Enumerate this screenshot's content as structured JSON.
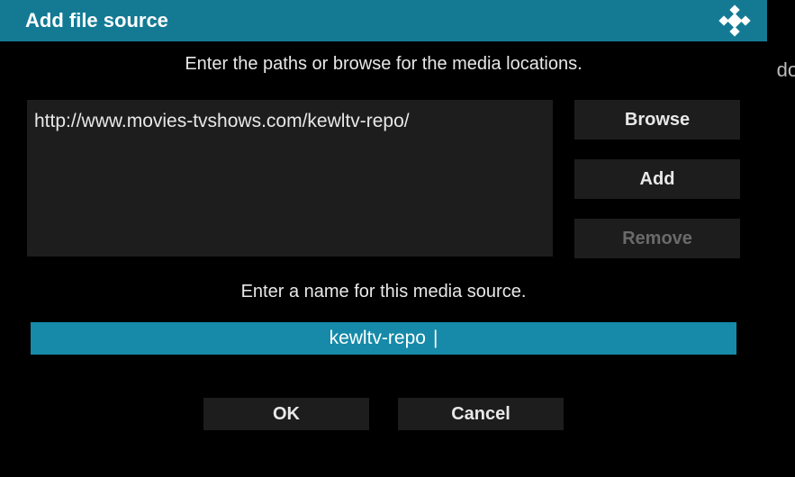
{
  "bg_text": "dow",
  "dialog": {
    "title": "Add file source",
    "instruction_paths": "Enter the paths or browse for the media locations.",
    "path_value": "http://www.movies-tvshows.com/kewltv-repo/",
    "buttons": {
      "browse": "Browse",
      "add": "Add",
      "remove": "Remove"
    },
    "instruction_name": "Enter a name for this media source.",
    "name_value": "kewltv-repo",
    "ok": "OK",
    "cancel": "Cancel"
  }
}
